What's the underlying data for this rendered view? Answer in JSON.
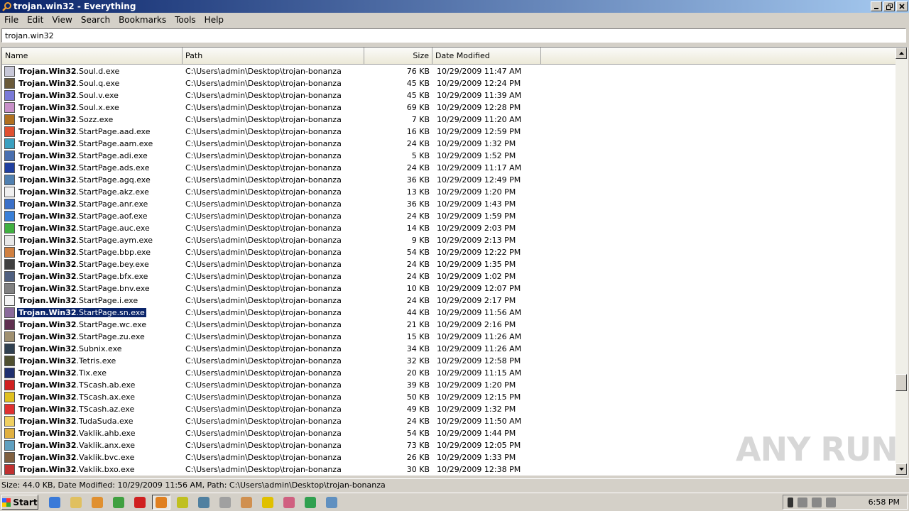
{
  "window": {
    "title": "trojan.win32 - Everything"
  },
  "menu": [
    "File",
    "Edit",
    "View",
    "Search",
    "Bookmarks",
    "Tools",
    "Help"
  ],
  "search": {
    "value": "trojan.win32"
  },
  "columns": {
    "name": "Name",
    "path": "Path",
    "size": "Size",
    "date": "Date Modified"
  },
  "rows": [
    {
      "bold": "Trojan.Win32",
      "rest": ".Soul.d.exe",
      "path": "C:\\Users\\admin\\Desktop\\trojan-bonanza",
      "size": "76 KB",
      "date": "10/29/2009 11:47 AM",
      "icon": "#c8c8d8"
    },
    {
      "bold": "Trojan.Win32",
      "rest": ".Soul.q.exe",
      "path": "C:\\Users\\admin\\Desktop\\trojan-bonanza",
      "size": "45 KB",
      "date": "10/29/2009 12:24 PM",
      "icon": "#6a5a3a"
    },
    {
      "bold": "Trojan.Win32",
      "rest": ".Soul.v.exe",
      "path": "C:\\Users\\admin\\Desktop\\trojan-bonanza",
      "size": "45 KB",
      "date": "10/29/2009 11:39 AM",
      "icon": "#7a7ad8"
    },
    {
      "bold": "Trojan.Win32",
      "rest": ".Soul.x.exe",
      "path": "C:\\Users\\admin\\Desktop\\trojan-bonanza",
      "size": "69 KB",
      "date": "10/29/2009 12:28 PM",
      "icon": "#c890c8"
    },
    {
      "bold": "Trojan.Win32",
      "rest": ".Sozz.exe",
      "path": "C:\\Users\\admin\\Desktop\\trojan-bonanza",
      "size": "7 KB",
      "date": "10/29/2009 11:20 AM",
      "icon": "#b07020"
    },
    {
      "bold": "Trojan.Win32",
      "rest": ".StartPage.aad.exe",
      "path": "C:\\Users\\admin\\Desktop\\trojan-bonanza",
      "size": "16 KB",
      "date": "10/29/2009 12:59 PM",
      "icon": "#e05030"
    },
    {
      "bold": "Trojan.Win32",
      "rest": ".StartPage.aam.exe",
      "path": "C:\\Users\\admin\\Desktop\\trojan-bonanza",
      "size": "24 KB",
      "date": "10/29/2009 1:32 PM",
      "icon": "#3aa0c0"
    },
    {
      "bold": "Trojan.Win32",
      "rest": ".StartPage.adi.exe",
      "path": "C:\\Users\\admin\\Desktop\\trojan-bonanza",
      "size": "5 KB",
      "date": "10/29/2009 1:52 PM",
      "icon": "#4a70b0"
    },
    {
      "bold": "Trojan.Win32",
      "rest": ".StartPage.ads.exe",
      "path": "C:\\Users\\admin\\Desktop\\trojan-bonanza",
      "size": "24 KB",
      "date": "10/29/2009 11:17 AM",
      "icon": "#2040a0"
    },
    {
      "bold": "Trojan.Win32",
      "rest": ".StartPage.agq.exe",
      "path": "C:\\Users\\admin\\Desktop\\trojan-bonanza",
      "size": "36 KB",
      "date": "10/29/2009 12:49 PM",
      "icon": "#5080b0"
    },
    {
      "bold": "Trojan.Win32",
      "rest": ".StartPage.akz.exe",
      "path": "C:\\Users\\admin\\Desktop\\trojan-bonanza",
      "size": "13 KB",
      "date": "10/29/2009 1:20 PM",
      "icon": "#f0f0f0"
    },
    {
      "bold": "Trojan.Win32",
      "rest": ".StartPage.anr.exe",
      "path": "C:\\Users\\admin\\Desktop\\trojan-bonanza",
      "size": "36 KB",
      "date": "10/29/2009 1:43 PM",
      "icon": "#3a70c8"
    },
    {
      "bold": "Trojan.Win32",
      "rest": ".StartPage.aof.exe",
      "path": "C:\\Users\\admin\\Desktop\\trojan-bonanza",
      "size": "24 KB",
      "date": "10/29/2009 1:59 PM",
      "icon": "#3a80d8"
    },
    {
      "bold": "Trojan.Win32",
      "rest": ".StartPage.auc.exe",
      "path": "C:\\Users\\admin\\Desktop\\trojan-bonanza",
      "size": "14 KB",
      "date": "10/29/2009 2:03 PM",
      "icon": "#40b040"
    },
    {
      "bold": "Trojan.Win32",
      "rest": ".StartPage.aym.exe",
      "path": "C:\\Users\\admin\\Desktop\\trojan-bonanza",
      "size": "9 KB",
      "date": "10/29/2009 2:13 PM",
      "icon": "#e8e8e8"
    },
    {
      "bold": "Trojan.Win32",
      "rest": ".StartPage.bbp.exe",
      "path": "C:\\Users\\admin\\Desktop\\trojan-bonanza",
      "size": "54 KB",
      "date": "10/29/2009 12:22 PM",
      "icon": "#d08040"
    },
    {
      "bold": "Trojan.Win32",
      "rest": ".StartPage.bey.exe",
      "path": "C:\\Users\\admin\\Desktop\\trojan-bonanza",
      "size": "24 KB",
      "date": "10/29/2009 1:35 PM",
      "icon": "#404040"
    },
    {
      "bold": "Trojan.Win32",
      "rest": ".StartPage.bfx.exe",
      "path": "C:\\Users\\admin\\Desktop\\trojan-bonanza",
      "size": "24 KB",
      "date": "10/29/2009 1:02 PM",
      "icon": "#506080"
    },
    {
      "bold": "Trojan.Win32",
      "rest": ".StartPage.bnv.exe",
      "path": "C:\\Users\\admin\\Desktop\\trojan-bonanza",
      "size": "10 KB",
      "date": "10/29/2009 12:07 PM",
      "icon": "#808080"
    },
    {
      "bold": "Trojan.Win32",
      "rest": ".StartPage.i.exe",
      "path": "C:\\Users\\admin\\Desktop\\trojan-bonanza",
      "size": "24 KB",
      "date": "10/29/2009 2:17 PM",
      "icon": "#f4f4f4"
    },
    {
      "bold": "Trojan.Win32",
      "rest": ".StartPage.sn.exe",
      "path": "C:\\Users\\admin\\Desktop\\trojan-bonanza",
      "size": "44 KB",
      "date": "10/29/2009 11:56 AM",
      "icon": "#8a6a9a",
      "selected": true
    },
    {
      "bold": "Trojan.Win32",
      "rest": ".StartPage.wc.exe",
      "path": "C:\\Users\\admin\\Desktop\\trojan-bonanza",
      "size": "21 KB",
      "date": "10/29/2009 2:16 PM",
      "icon": "#603050"
    },
    {
      "bold": "Trojan.Win32",
      "rest": ".StartPage.zu.exe",
      "path": "C:\\Users\\admin\\Desktop\\trojan-bonanza",
      "size": "15 KB",
      "date": "10/29/2009 11:26 AM",
      "icon": "#a09070"
    },
    {
      "bold": "Trojan.Win32",
      "rest": ".Subnix.exe",
      "path": "C:\\Users\\admin\\Desktop\\trojan-bonanza",
      "size": "34 KB",
      "date": "10/29/2009 11:26 AM",
      "icon": "#304050"
    },
    {
      "bold": "Trojan.Win32",
      "rest": ".Tetris.exe",
      "path": "C:\\Users\\admin\\Desktop\\trojan-bonanza",
      "size": "32 KB",
      "date": "10/29/2009 12:58 PM",
      "icon": "#505030"
    },
    {
      "bold": "Trojan.Win32",
      "rest": ".Tix.exe",
      "path": "C:\\Users\\admin\\Desktop\\trojan-bonanza",
      "size": "20 KB",
      "date": "10/29/2009 11:15 AM",
      "icon": "#203070"
    },
    {
      "bold": "Trojan.Win32",
      "rest": ".TScash.ab.exe",
      "path": "C:\\Users\\admin\\Desktop\\trojan-bonanza",
      "size": "39 KB",
      "date": "10/29/2009 1:20 PM",
      "icon": "#d02020"
    },
    {
      "bold": "Trojan.Win32",
      "rest": ".TScash.ax.exe",
      "path": "C:\\Users\\admin\\Desktop\\trojan-bonanza",
      "size": "50 KB",
      "date": "10/29/2009 12:15 PM",
      "icon": "#e0c020"
    },
    {
      "bold": "Trojan.Win32",
      "rest": ".TScash.az.exe",
      "path": "C:\\Users\\admin\\Desktop\\trojan-bonanza",
      "size": "49 KB",
      "date": "10/29/2009 1:32 PM",
      "icon": "#e03030"
    },
    {
      "bold": "Trojan.Win32",
      "rest": ".TudaSuda.exe",
      "path": "C:\\Users\\admin\\Desktop\\trojan-bonanza",
      "size": "24 KB",
      "date": "10/29/2009 11:50 AM",
      "icon": "#f0d060"
    },
    {
      "bold": "Trojan.Win32",
      "rest": ".Vaklik.ahb.exe",
      "path": "C:\\Users\\admin\\Desktop\\trojan-bonanza",
      "size": "54 KB",
      "date": "10/29/2009 1:44 PM",
      "icon": "#e0b040"
    },
    {
      "bold": "Trojan.Win32",
      "rest": ".Vaklik.anx.exe",
      "path": "C:\\Users\\admin\\Desktop\\trojan-bonanza",
      "size": "73 KB",
      "date": "10/29/2009 12:05 PM",
      "icon": "#60a0c0"
    },
    {
      "bold": "Trojan.Win32",
      "rest": ".Vaklik.bvc.exe",
      "path": "C:\\Users\\admin\\Desktop\\trojan-bonanza",
      "size": "26 KB",
      "date": "10/29/2009 1:33 PM",
      "icon": "#806040"
    },
    {
      "bold": "Trojan.Win32",
      "rest": ".Vaklik.bxo.exe",
      "path": "C:\\Users\\admin\\Desktop\\trojan-bonanza",
      "size": "30 KB",
      "date": "10/29/2009 12:38 PM",
      "icon": "#c03030"
    }
  ],
  "status": "Size: 44.0 KB, Date Modified: 10/29/2009 11:56 AM, Path: C:\\Users\\admin\\Desktop\\trojan-bonanza",
  "taskbar": {
    "start_label": "Start",
    "quick": [
      {
        "name": "ie-icon",
        "color": "#3a7ad8"
      },
      {
        "name": "explorer-icon",
        "color": "#e0c060"
      },
      {
        "name": "media-player-icon",
        "color": "#e09030"
      },
      {
        "name": "chrome-icon",
        "color": "#40a040"
      },
      {
        "name": "opera-icon",
        "color": "#d02020"
      },
      {
        "name": "everything-icon",
        "color": "#e08020",
        "active": true
      },
      {
        "name": "gear-app-icon",
        "color": "#c0c020"
      },
      {
        "name": "network-app-icon",
        "color": "#5080a0"
      },
      {
        "name": "hand-app-icon",
        "color": "#a0a0a0"
      },
      {
        "name": "grid-app-icon",
        "color": "#d09050"
      },
      {
        "name": "radiation-icon",
        "color": "#e0c000"
      },
      {
        "name": "flower-icon",
        "color": "#d06080"
      },
      {
        "name": "green-box-icon",
        "color": "#30a050"
      },
      {
        "name": "window-app-icon",
        "color": "#6090c0"
      }
    ],
    "clock": "6:58 PM"
  },
  "watermark": "ANY RUN"
}
